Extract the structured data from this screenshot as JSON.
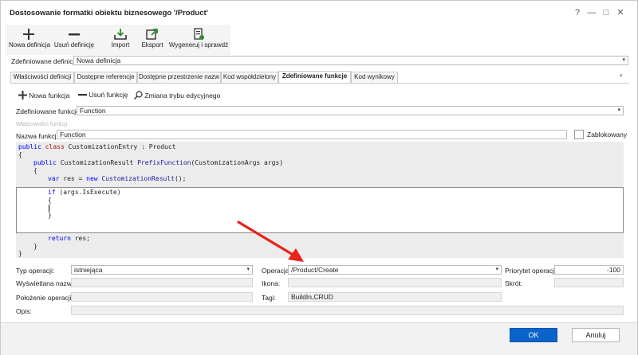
{
  "window": {
    "title": "Dostosowanie formatki obiektu biznesowego '/Product'"
  },
  "window_controls": {
    "help": "?",
    "minimize": "—",
    "maximize": "□",
    "close": "✕"
  },
  "toolbar": {
    "new_def": "Nowa definicja",
    "delete_def": "Usuń definicję",
    "import": "Import",
    "export": "Eksport",
    "generate": "Wygeneruj i sprawdź"
  },
  "defined_definitions": {
    "label": "Zdefiniowane definicje:",
    "value": "Nowa definicja"
  },
  "tabs": [
    {
      "label": "Właściwości definicji"
    },
    {
      "label": "Dostępne referencje"
    },
    {
      "label": "Dostępne przestrzenie nazw"
    },
    {
      "label": "Kod współdzielony"
    },
    {
      "label": "Zdefiniowane funkcje"
    },
    {
      "label": "Kod wynikowy"
    }
  ],
  "func_toolbar": {
    "new_func": "Nowa funkcja",
    "delete_func": "Usuń funkcję",
    "edit_mode": "Zmiana trybu edycyjnego"
  },
  "defined_functions": {
    "label": "Zdefiniowane funkcje:",
    "value": "Function"
  },
  "function_props_label": "Właściwości funkcji",
  "function_name": {
    "label": "Nazwa funkcji:",
    "value": "Function"
  },
  "locked_label": "Zablokowany",
  "code": {
    "line1_kw1": "public",
    "line1_kw2": "class",
    "line1_rest": " CustomizationEntry : Product",
    "line2": "{",
    "line3_kw": "public",
    "line3_type": " CustomizationResult ",
    "line3_fn": "PrefixFunction",
    "line3_rest": "(CustomizationArgs args)",
    "line4": "{",
    "line5_kw": "var",
    "line5_mid": " res = ",
    "line5_kw2": "new",
    "line5_fn": " CustomizationResult",
    "line5_rest": "();",
    "edit_line1_kw": "if",
    "edit_line1_rest": " (args.IsExecute)",
    "edit_line2": "{",
    "edit_line4": "}",
    "tail_line1_kw": "return",
    "tail_line1_rest": " res;",
    "tail_line2": "}",
    "tail_line3": "}"
  },
  "operation_type": {
    "label": "Typ operacji:",
    "value": "istniejąca"
  },
  "operation": {
    "label": "Operacja:",
    "value": "/Product/Create"
  },
  "priority": {
    "label": "Priorytet operacji:",
    "value": "-100"
  },
  "display_name": {
    "label": "Wyświetlana nazwa:",
    "value": ""
  },
  "icon": {
    "label": "Ikona:",
    "value": ""
  },
  "shortcut": {
    "label": "Skrót:",
    "value": ""
  },
  "position": {
    "label": "Położenie operacji:",
    "value": ""
  },
  "tags": {
    "label": "Tagi:",
    "value": "BuildIn,CRUD"
  },
  "description": {
    "label": "Opis:",
    "value": ""
  },
  "buttons": {
    "ok": "OK",
    "cancel": "Anuluj"
  },
  "colors": {
    "accent": "#0a63c9",
    "code_bg": "#ececec",
    "arrow": "#e8231a"
  },
  "icons": {
    "new": "plus-icon",
    "delete": "minus-icon",
    "import": "import-tray-icon",
    "export": "export-arrow-icon",
    "generate": "document-check-icon",
    "search": "magnifier-icon"
  }
}
